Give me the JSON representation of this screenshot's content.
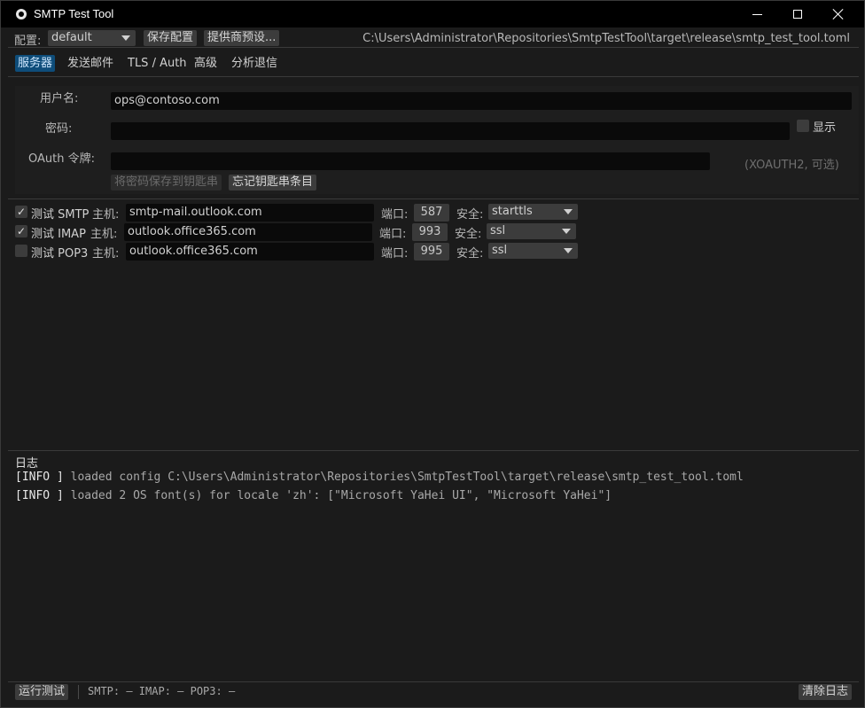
{
  "window": {
    "title": "SMTP Test Tool"
  },
  "toolbar": {
    "profile_label": "配置:",
    "profile_value": "default",
    "save_profile": "保存配置",
    "provider_presets": "提供商预设...",
    "config_path": "C:\\Users\\Administrator\\Repositories\\SmtpTestTool\\target\\release\\smtp_test_tool.toml"
  },
  "tabs": [
    {
      "label": "服务器",
      "active": true
    },
    {
      "label": "发送邮件",
      "active": false
    },
    {
      "label": "TLS / Auth",
      "active": false
    },
    {
      "label": "高级",
      "active": false
    },
    {
      "label": "分析退信",
      "active": false
    }
  ],
  "auth": {
    "username_label": "用户名:",
    "username_value": "ops@contoso.com",
    "password_label": "密码:",
    "password_value": "",
    "show_label": "显示",
    "show_checked": false,
    "oauth_label": "OAuth 令牌:",
    "oauth_value": "",
    "oauth_hint": "(XOAUTH2, 可选)",
    "save_keyring": "将密码保存到钥匙串",
    "forget_keyring": "忘记钥匙串条目"
  },
  "servers": [
    {
      "check_label": "测试 SMTP",
      "checked": true,
      "host_label": "主机:",
      "host": "smtp-mail.outlook.com",
      "port_label": "端口:",
      "port": "587",
      "security_label": "安全:",
      "security": "starttls"
    },
    {
      "check_label": "测试 IMAP",
      "checked": true,
      "host_label": "主机:",
      "host": "outlook.office365.com",
      "port_label": "端口:",
      "port": "993",
      "security_label": "安全:",
      "security": "ssl"
    },
    {
      "check_label": "测试 POP3",
      "checked": false,
      "host_label": "主机:",
      "host": "outlook.office365.com",
      "port_label": "端口:",
      "port": "995",
      "security_label": "安全:",
      "security": "ssl"
    }
  ],
  "log": {
    "title": "日志",
    "lines": [
      {
        "level": "[INFO ]",
        "text": " loaded config C:\\Users\\Administrator\\Repositories\\SmtpTestTool\\target\\release\\smtp_test_tool.toml"
      },
      {
        "level": "[INFO ]",
        "text": " loaded 2 OS font(s) for locale 'zh': [\"Microsoft YaHei UI\", \"Microsoft YaHei\"]"
      }
    ]
  },
  "statusbar": {
    "run_tests": "运行测试",
    "status_text": "SMTP: – IMAP: – POP3: –",
    "clear_log": "清除日志"
  },
  "colors": {
    "accent": "#0e4d7a",
    "window_bg": "#1b1b1b",
    "titlebar_bg": "#000000"
  },
  "icons": {
    "app": "app-logo-icon",
    "dropdown": "chevron-down-icon"
  }
}
